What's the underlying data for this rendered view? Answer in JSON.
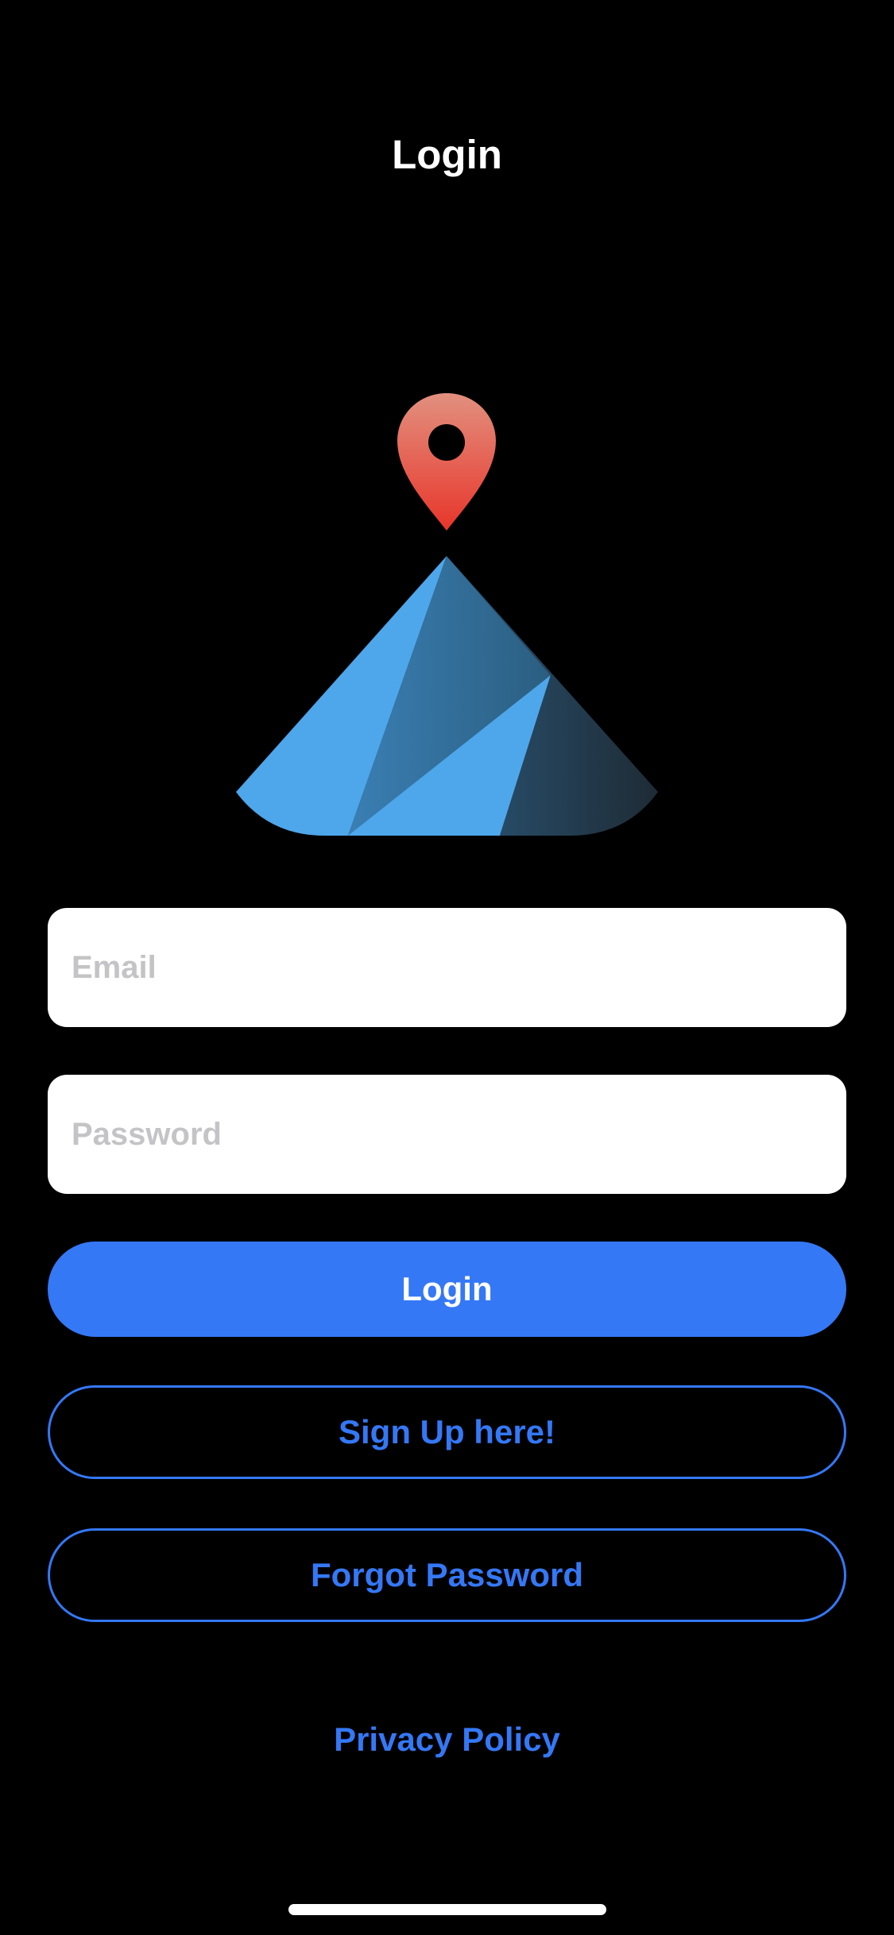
{
  "nav": {
    "title": "Login"
  },
  "logo": {
    "icon": "map-pin-icon",
    "pin_color_top": "#e08a7a",
    "pin_color_bottom": "#e8362a",
    "mountain_light": "#4ea6eb",
    "mountain_dark": "#1e2b35"
  },
  "form": {
    "email": {
      "value": "",
      "placeholder": "Email"
    },
    "password": {
      "value": "",
      "placeholder": "Password"
    }
  },
  "buttons": {
    "login_label": "Login",
    "signup_label": "Sign Up here!",
    "forgot_label": "Forgot Password"
  },
  "links": {
    "privacy_label": "Privacy Policy"
  },
  "colors": {
    "background": "#000000",
    "accent": "#3478f6",
    "field_background": "#ffffff",
    "placeholder": "#c4c4c6"
  }
}
